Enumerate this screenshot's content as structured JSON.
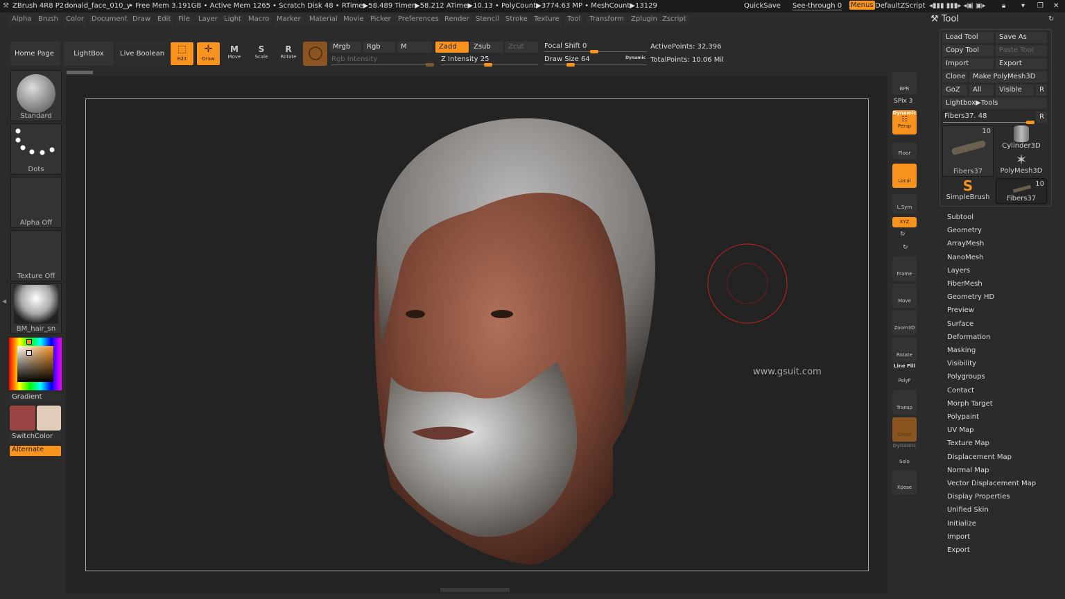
{
  "titlebar": {
    "app": "ZBrush 4R8 P2",
    "doc": "donald_face_010_y",
    "stats": "• Free Mem 3.191GB • Active Mem 1265 • Scratch Disk 48 •  RTime▶58.489 Timer▶58.212 ATime▶10.13 • PolyCount▶3774.63 MP  • MeshCount▶13129",
    "quicksave": "QuickSave",
    "seethrough": "See-through  0",
    "menus": "Menus",
    "defaultzscript": "DefaultZScript"
  },
  "menus": [
    "Alpha",
    "Brush",
    "Color",
    "Document",
    "Draw",
    "Edit",
    "File",
    "Layer",
    "Light",
    "Macro",
    "Marker",
    "Material",
    "Movie",
    "Picker",
    "Preferences",
    "Render",
    "Stencil",
    "Stroke",
    "Texture",
    "Tool",
    "Transform",
    "Zplugin",
    "Zscript"
  ],
  "toolbar": {
    "home": "Home Page",
    "lightbox": "LightBox",
    "liveboolean": "Live Boolean",
    "edit": "Edit",
    "draw": "Draw",
    "move": "Move",
    "scale": "Scale",
    "rotate": "Rotate",
    "mrgb": "Mrgb",
    "rgb": "Rgb",
    "m": "M",
    "zadd": "Zadd",
    "zsub": "Zsub",
    "zcut": "Zcut",
    "rgb_intensity": "Rgb Intensity",
    "z_intensity": "Z Intensity 25",
    "focal_shift": "Focal Shift 0",
    "draw_size": "Draw Size 64",
    "dynamic": "Dynamic",
    "active_points": "ActivePoints: 32,396",
    "total_points": "TotalPoints: 10.06 Mil",
    "z_intensity_value": 25,
    "focal_shift_value": 0,
    "draw_size_value": 64
  },
  "left": {
    "brush": "Standard",
    "stroke": "Dots",
    "alpha": "Alpha Off",
    "texture": "Texture Off",
    "material": "BM_hair_sn",
    "gradient": "Gradient",
    "switchcolor": "SwitchColor",
    "alternate": "Alternate",
    "main_color": "#9a4444",
    "secondary_color": "#e0ccb8"
  },
  "viewport": {
    "watermark": "www.gsuit.com"
  },
  "rightshelf": {
    "bpr": "BPR",
    "spix": "SPix 3",
    "dynamic": "Dynamic",
    "persp": "Persp",
    "floor": "Floor",
    "local": "Local",
    "lsym": "L.Sym",
    "xyz": "XYZ",
    "frame": "Frame",
    "move": "Move",
    "zoom3d": "Zoom3D",
    "rotate": "Rotate",
    "linefill": "Line Fill",
    "polyf": "PolyF",
    "transp": "Transp",
    "ghost": "Ghost",
    "dynamic2": "Dynamic",
    "solo": "Solo",
    "xpose": "Xpose"
  },
  "tool": {
    "title": "Tool",
    "load": "Load Tool",
    "saveas": "Save As",
    "copy": "Copy Tool",
    "paste": "Paste Tool",
    "import": "Import",
    "export": "Export",
    "clone": "Clone",
    "makepoly": "Make PolyMesh3D",
    "goz": "GoZ",
    "all": "All",
    "visible": "Visible",
    "r": "R",
    "lightbox": "Lightbox▶Tools",
    "current": "Fibers37. 48",
    "thumbs": [
      {
        "name": "Fibers37",
        "count": "10"
      },
      {
        "name": "Cylinder3D"
      },
      {
        "name": "PolyMesh3D"
      },
      {
        "name": "SimpleBrush"
      },
      {
        "name": "Fibers37",
        "count": "10"
      }
    ],
    "items": [
      "Subtool",
      "Geometry",
      "ArrayMesh",
      "NanoMesh",
      "Layers",
      "FiberMesh",
      "Geometry HD",
      "Preview",
      "Surface",
      "Deformation",
      "Masking",
      "Visibility",
      "Polygroups",
      "Contact",
      "Morph Target",
      "Polypaint",
      "UV Map",
      "Texture Map",
      "Displacement Map",
      "Normal Map",
      "Vector Displacement Map",
      "Display Properties",
      "Unified Skin",
      "Initialize",
      "Import",
      "Export"
    ]
  },
  "accent": "#f7931e"
}
